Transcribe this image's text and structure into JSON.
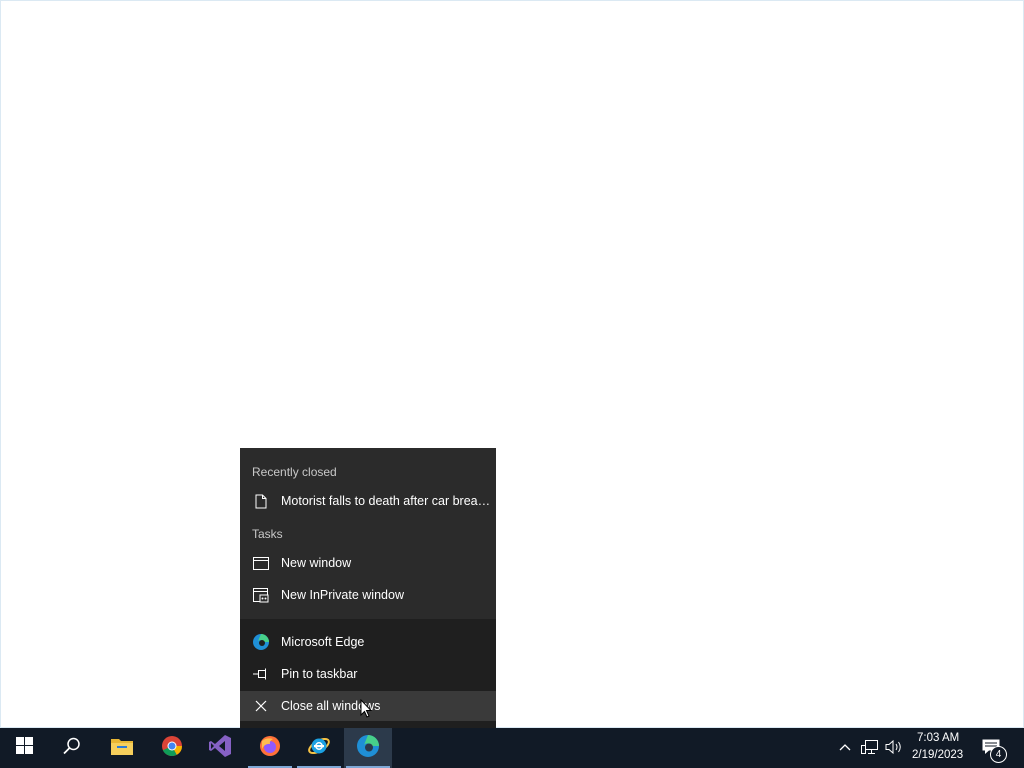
{
  "jumplist": {
    "recently_closed_header": "Recently closed",
    "recent_item": "Motorist falls to death after car breaks...",
    "tasks_header": "Tasks",
    "tasks": [
      "New window",
      "New InPrivate window"
    ],
    "app_name": "Microsoft Edge",
    "pin_label": "Pin to taskbar",
    "close_label": "Close all windows"
  },
  "taskbar": {
    "apps": [
      "start-icon",
      "search-icon",
      "file-explorer-icon",
      "chrome-icon",
      "visual-studio-icon",
      "firefox-icon",
      "internet-explorer-icon",
      "edge-icon"
    ],
    "time": "7:03 AM",
    "date": "2/19/2023",
    "notification_count": "4"
  },
  "colors": {
    "taskbar_bg": "#111a26",
    "menu_bg": "#2b2b2b",
    "menu_bottom_bg": "#1f1f1f"
  }
}
